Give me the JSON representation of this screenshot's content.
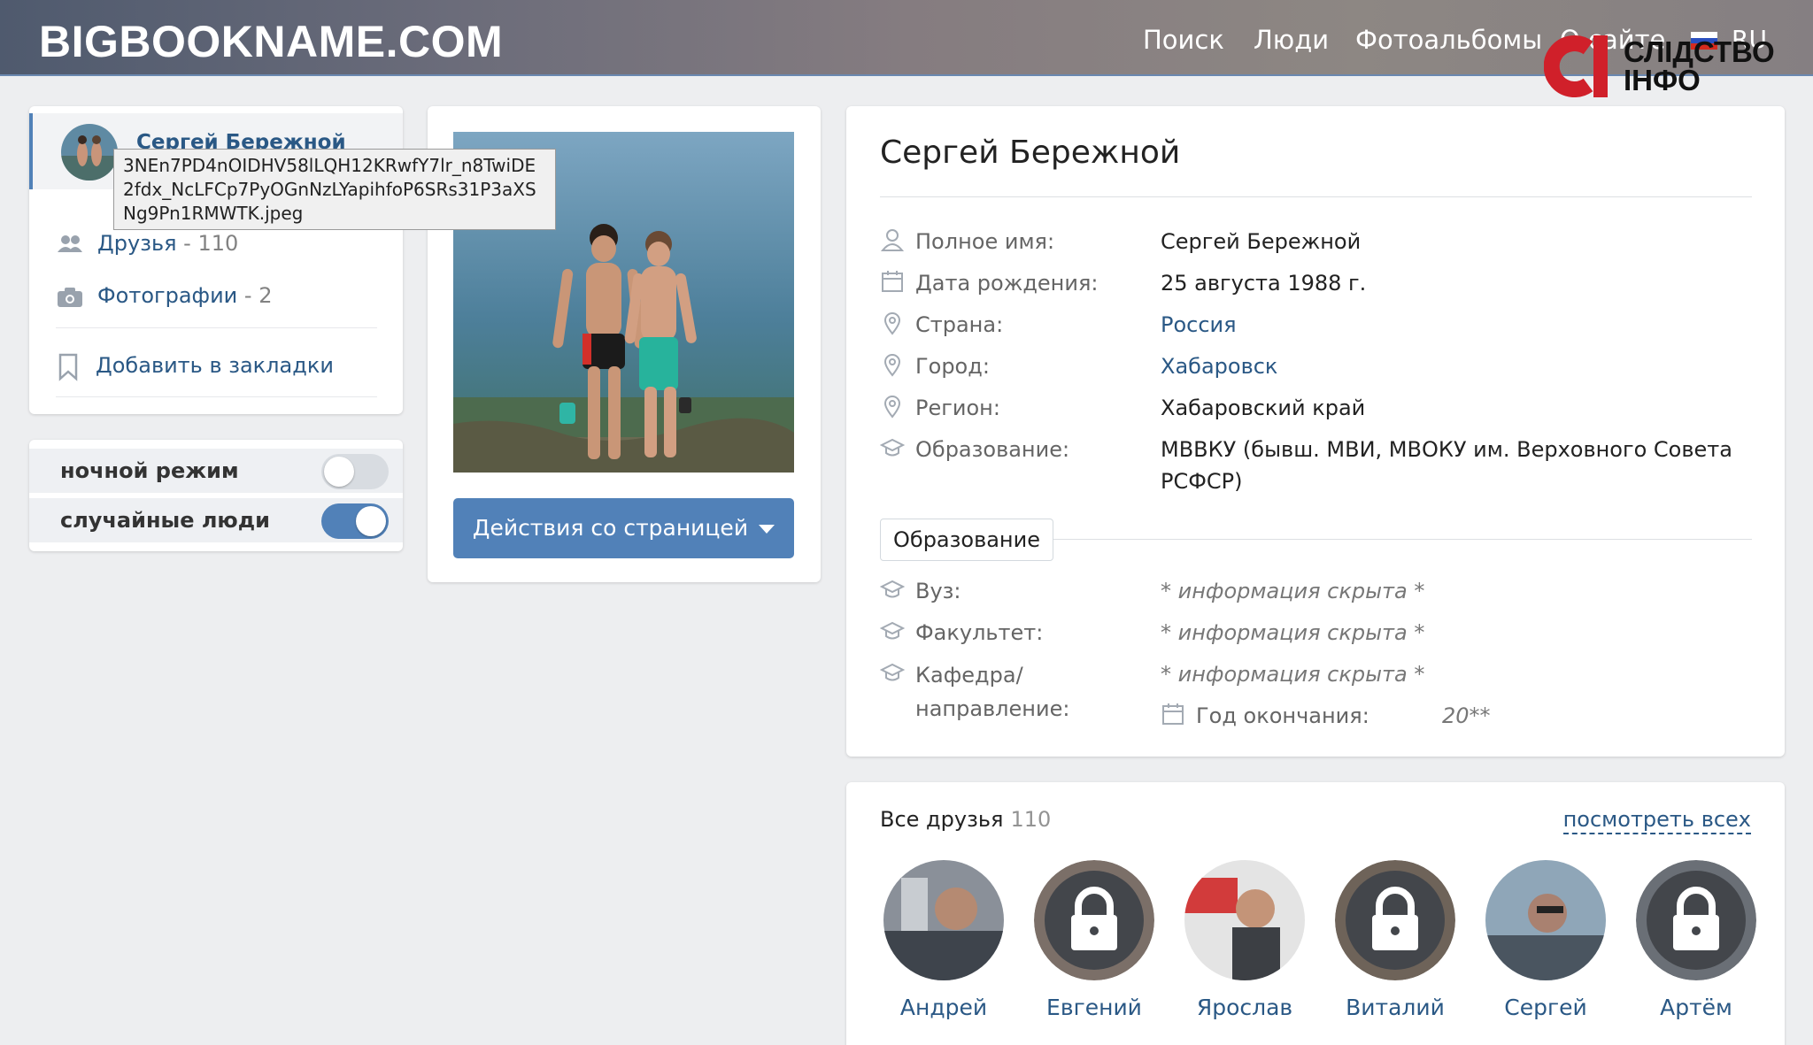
{
  "header": {
    "logo": "BIGBOOKNAME.COM",
    "nav": [
      "Поиск",
      "Люди",
      "Фотоальбомы",
      "О сайте"
    ],
    "lang": "RU"
  },
  "watermark": {
    "line1": "СЛІДСТВО",
    "line2": "ІНФО"
  },
  "left_card": {
    "name": "Сергей Бережной",
    "tooltip": "3NEn7PD4nOIDHV58lLQH12KRwfY7lr_n8TwiDE2fdx_NcLFCp7PyOGnNzLYapihfoP6SRs31P3aXSNg9Pn1RMWTK.jpeg",
    "friends_label": "Друзья",
    "friends_count": " - 110",
    "photos_label": "Фотографии",
    "photos_count": " - 2",
    "bookmark_label": "Добавить в закладки"
  },
  "toggles": [
    {
      "label": "ночной режим",
      "on": false
    },
    {
      "label": "случайные люди",
      "on": true
    }
  ],
  "photo_card": {
    "actions_label": "Действия со страницей"
  },
  "info": {
    "title": "Сергей Бережной",
    "rows": [
      {
        "label": "Полное имя:",
        "value": "Сергей Бережной"
      },
      {
        "label": "Дата рождения:",
        "value": "25 августа 1988 г."
      },
      {
        "label": "Страна:",
        "value": "Россия"
      },
      {
        "label": "Город:",
        "value": "Хабаровск"
      },
      {
        "label": "Регион:",
        "value": "Хабаровский край"
      },
      {
        "label": "Образование:",
        "value": "МВВКУ (бывш. МВИ, МВОКУ им. Верховного Совета РСФСР)"
      }
    ],
    "edu_tab": "Образование",
    "edu_rows": [
      {
        "label": "Вуз:",
        "value": "* информация скрыта *"
      },
      {
        "label": "Факультет:",
        "value": "* информация скрыта *"
      },
      {
        "label": "Кафедра/ направление:",
        "value": "* информация скрыта *"
      }
    ],
    "grad_label": "Год окончания:",
    "grad_value": "20**"
  },
  "friends": {
    "title": "Все друзья",
    "count": "110",
    "see_all": "посмотреть всех",
    "list": [
      {
        "name": "Андрей",
        "locked": false
      },
      {
        "name": "Евгений",
        "locked": true
      },
      {
        "name": "Ярослав",
        "locked": false
      },
      {
        "name": "Виталий",
        "locked": true
      },
      {
        "name": "Сергей",
        "locked": false
      },
      {
        "name": "Артём",
        "locked": true
      }
    ]
  },
  "colors": {
    "accent": "#5181b8",
    "link": "#2a5885",
    "watermark_red": "#d0202a"
  }
}
